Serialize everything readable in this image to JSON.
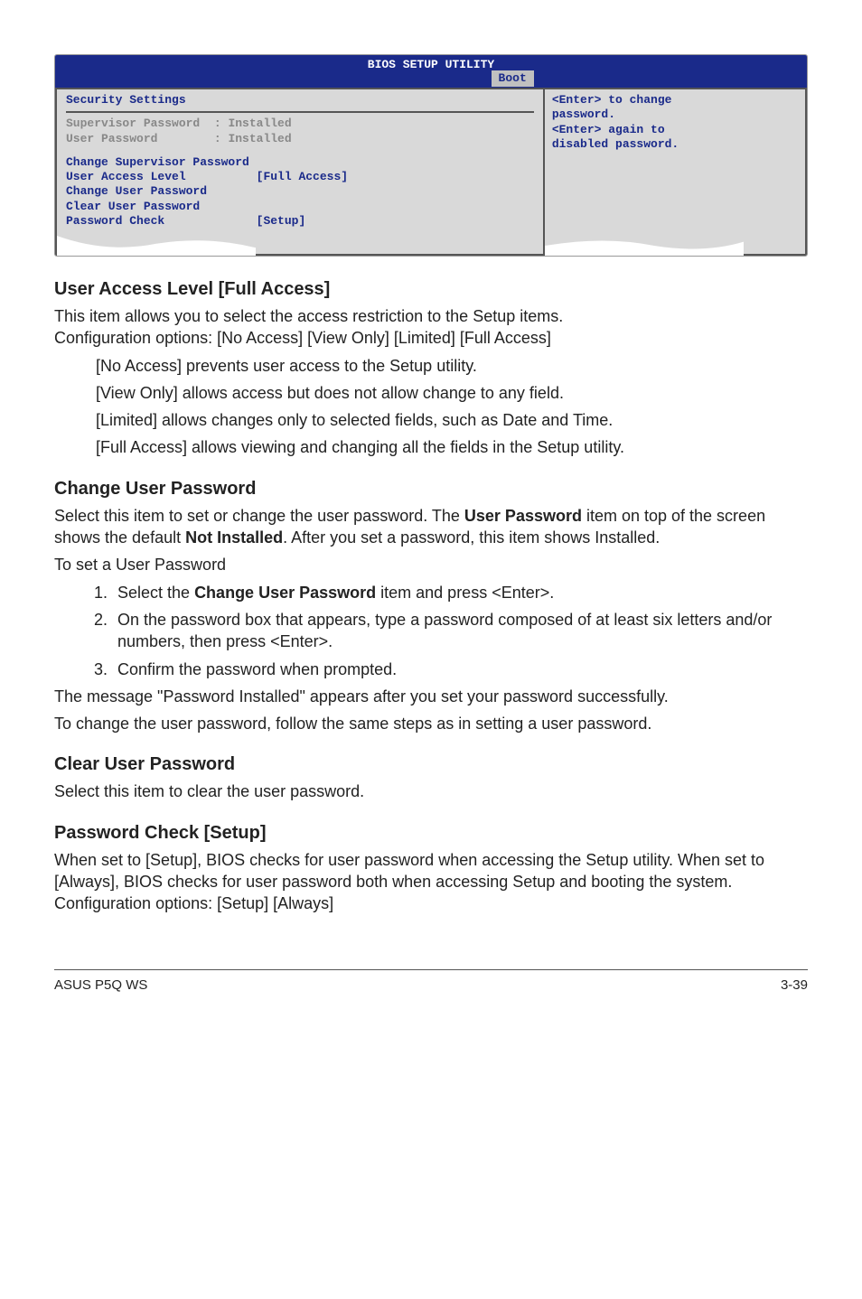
{
  "bios": {
    "title": "BIOS SETUP UTILITY",
    "tab": "Boot",
    "section_heading": "Security Settings",
    "sup_label": "Supervisor Password",
    "sup_value": ": Installed",
    "user_label": "User Password",
    "user_value": ": Installed",
    "items": {
      "change_sup": "Change Supervisor Password",
      "ual_label": "User Access Level",
      "ual_value": "[Full Access]",
      "change_user": "Change User Password",
      "clear_user": "Clear User Password",
      "pwcheck_label": "Password Check",
      "pwcheck_value": "[Setup]"
    },
    "help": {
      "l1": "<Enter> to change",
      "l2": "password.",
      "l3": "<Enter> again to",
      "l4": "disabled password."
    }
  },
  "doc": {
    "h_ual": "User Access Level [Full Access]",
    "ual_p1": "This item allows you to select the access restriction to the Setup items.",
    "ual_p2": "Configuration options: [No Access] [View Only] [Limited] [Full Access]",
    "ual_noaccess": "[No Access] prevents user access to the Setup utility.",
    "ual_viewonly": "[View Only] allows access but does not allow change to any field.",
    "ual_limited": "[Limited] allows changes only to selected fields, such as Date and Time.",
    "ual_full": "[Full Access] allows viewing and changing all the fields in the Setup utility.",
    "h_cup": "Change User Password",
    "cup_p1a": "Select this item to set or change the user password. The ",
    "cup_p1b": "User Password",
    "cup_p1c": " item on top of the screen shows the default ",
    "cup_p1d": "Not Installed",
    "cup_p1e": ". After you set a password, this item shows Installed.",
    "cup_p2": "To set a User Password",
    "cup_li1a": "Select the ",
    "cup_li1b": "Change User Password",
    "cup_li1c": " item and press <Enter>.",
    "cup_li2": "On the password box that appears, type a password composed of at least six letters and/or numbers, then press <Enter>.",
    "cup_li3": "Confirm the password when prompted.",
    "cup_p3": "The message \"Password Installed\" appears after you set your password successfully.",
    "cup_p4": "To change the user password, follow the same steps as in setting a user password.",
    "h_clup": "Clear User Password",
    "clup_p": "Select this item to clear the user password.",
    "h_pc": "Password Check [Setup]",
    "pc_p1": "When set to [Setup], BIOS checks for user password when accessing the Setup utility. When set to [Always], BIOS checks for user password both when accessing Setup and booting the system.",
    "pc_p2": "Configuration options: [Setup] [Always]",
    "footer_left": "ASUS P5Q WS",
    "footer_right": "3-39"
  }
}
